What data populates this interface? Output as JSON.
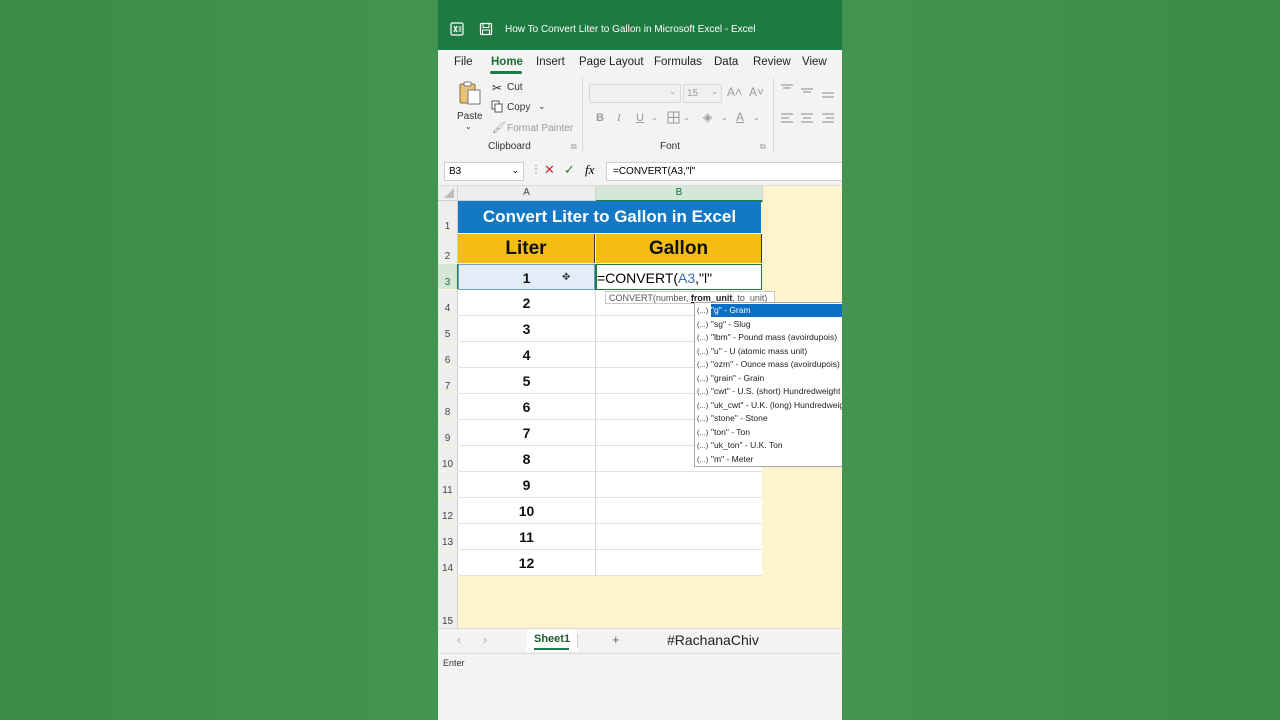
{
  "window": {
    "title": "How To Convert Liter to Gallon in Microsoft Excel  -  Excel"
  },
  "ribbon_tabs": [
    "File",
    "Home",
    "Insert",
    "Page Layout",
    "Formulas",
    "Data",
    "Review",
    "View"
  ],
  "active_tab": "Home",
  "clipboard": {
    "paste_label": "Paste",
    "cut_label": "Cut",
    "copy_label": "Copy",
    "format_painter_label": "Format Painter",
    "group_label": "Clipboard"
  },
  "font": {
    "size_value": "15",
    "bold": "B",
    "italic": "I",
    "underline": "U",
    "group_label": "Font"
  },
  "formula_bar": {
    "name_box": "B3",
    "fx_label": "fx",
    "formula": "=CONVERT(A3,\"l\""
  },
  "columns": [
    "A",
    "B"
  ],
  "rows": [
    "1",
    "2",
    "3",
    "4",
    "5",
    "6",
    "7",
    "8",
    "9",
    "10",
    "11",
    "12",
    "13",
    "14",
    "15"
  ],
  "sheet": {
    "title": "Convert Liter to Gallon in Excel",
    "headers": [
      "Liter",
      "Gallon"
    ],
    "liters": [
      "1",
      "2",
      "3",
      "4",
      "5",
      "6",
      "7",
      "8",
      "9",
      "10",
      "11",
      "12"
    ]
  },
  "edit_cell": {
    "prefix": "=CONVERT(",
    "ref": "A3",
    "suffix": ",\"l\""
  },
  "tooltip": {
    "fn": "CONVERT(number, ",
    "bold_arg": "from_unit",
    "rest": ", to_unit)"
  },
  "autocomplete": {
    "icon_text": "(...)",
    "items": [
      "\"g\" - Gram",
      "\"sg\" - Slug",
      "\"lbm\" - Pound mass (avoirdupois)",
      "\"u\" - U (atomic mass unit)",
      "\"ozm\" - Ounce mass (avoirdupois)",
      "\"grain\" - Grain",
      "\"cwt\" - U.S. (short) Hundredweight",
      "\"uk_cwt\" - U.K. (long) Hundredweig",
      "\"stone\" - Stone",
      "\"ton\" - Ton",
      "\"uk_ton\" - U.K. Ton",
      "\"m\" - Meter"
    ]
  },
  "sheet_tabs": {
    "active": "Sheet1",
    "add_label": "+",
    "watermark": "#RachanaChiv"
  },
  "status": {
    "mode": "Enter"
  },
  "colors": {
    "excel_green": "#1e7a41",
    "title_blue": "#1479c4",
    "header_yellow": "#f4bd12",
    "selection_blue": "#0b6fc6",
    "cell_ref_blue": "#2f6db5"
  }
}
